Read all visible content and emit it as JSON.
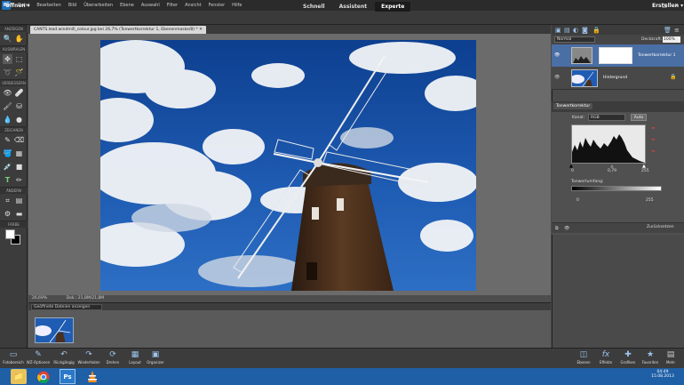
{
  "menu": {
    "logo": "Ps",
    "items": [
      "Datei",
      "Bearbeiten",
      "Bild",
      "Überarbeiten",
      "Ebene",
      "Auswahl",
      "Filter",
      "Ansicht",
      "Fenster",
      "Hilfe"
    ],
    "window_controls": [
      "–",
      "□",
      "✕"
    ]
  },
  "modebar": {
    "open_label": "Öffnen ▾",
    "modes": [
      "Schnell",
      "Assistent",
      "Experte"
    ],
    "active_mode": "Experte",
    "create_label": "Erstellen ▾"
  },
  "toolbox": {
    "sections": [
      "ANZEIGEN",
      "AUSWÄHLEN",
      "VERBESSERN",
      "ZEICHNEN",
      "ÄNDERN",
      "FARBE"
    ]
  },
  "document": {
    "tab_title": "CANTS.lead.windmill_colour.jpg bei 26,7% (Tonwertkorrektur 1, Ebenenmaske/8) * ✕",
    "zoom": "26,69%",
    "doc_info": "Dok.: 21,8M/21,8M"
  },
  "bin": {
    "selector_label": "Geöffnete Dateien anzeigen"
  },
  "layers": {
    "blend_mode": "Normal",
    "opacity_label": "Deckkraft:",
    "opacity_value": "100%",
    "items": [
      {
        "name": "Tonwertkorrektur 1",
        "selected": true
      },
      {
        "name": "Hintergrund",
        "selected": false
      }
    ]
  },
  "adjustment": {
    "tab_label": "Tonwertkorrektur",
    "channel_label": "Kanal:",
    "channel_value": "RGB",
    "auto_label": "Auto",
    "input_values": [
      "0",
      "0,79",
      "255"
    ],
    "output_label": "Tonwertumfang:",
    "output_values": [
      "0",
      "255"
    ],
    "reset_label": "Zurücksetzen"
  },
  "bottom_bar": {
    "left_items": [
      "Fotobereich",
      "WZ-Optionen",
      "Rückgängig",
      "Wiederholen",
      "Drehen",
      "Layout",
      "Organizer"
    ],
    "right_items": [
      "Ebenen",
      "Effekte",
      "Grafiken",
      "Favoriten",
      "Mehr"
    ]
  },
  "taskbar": {
    "time": "04:49",
    "date": "15.08.2013"
  },
  "colors": {
    "accent": "#1d6fb8",
    "layer_selected": "#4a6fa5",
    "sky": "#1a4fa0"
  }
}
